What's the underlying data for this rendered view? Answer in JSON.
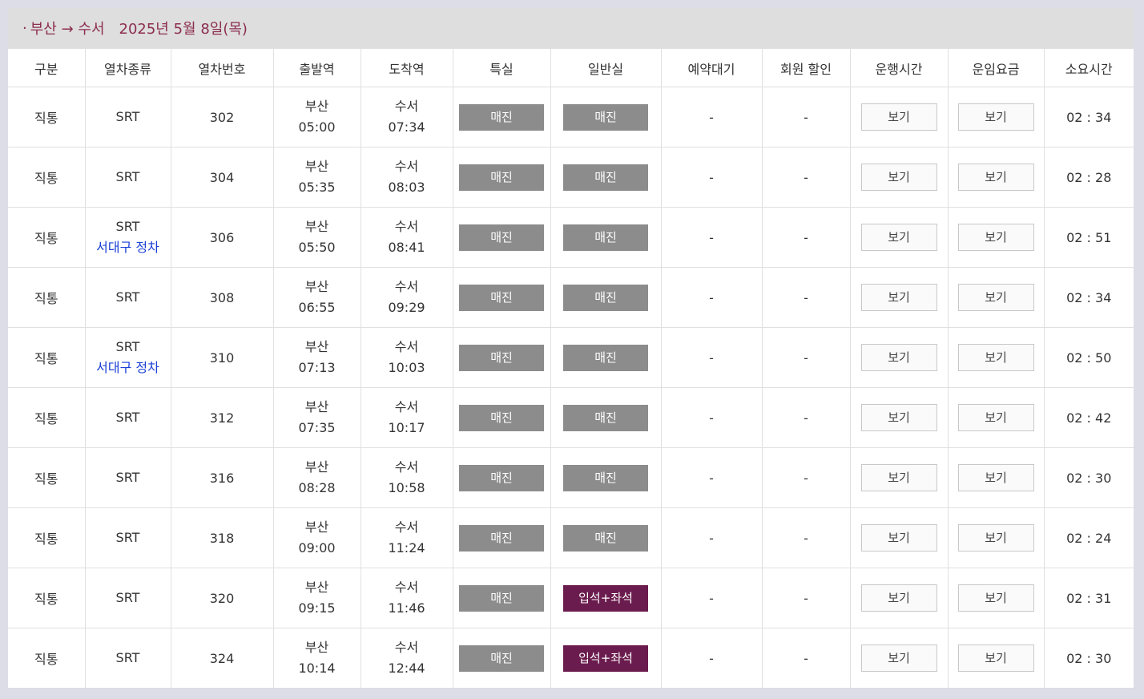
{
  "route": {
    "dot": "·",
    "text": "부산 → 수서",
    "date": "2025년 5월 8일(목)"
  },
  "headers": [
    "구분",
    "열차종류",
    "열차번호",
    "출발역",
    "도착역",
    "특실",
    "일반실",
    "예약대기",
    "회원 할인",
    "운행시간",
    "운임요금",
    "소요시간"
  ],
  "rows": [
    {
      "kind": "직통",
      "train": "SRT",
      "stop": "",
      "no": "302",
      "dep": "부산",
      "dep_time": "05:00",
      "arr": "수서",
      "arr_time": "07:34",
      "first": "매진",
      "first_avail": false,
      "std": "매진",
      "std_avail": false,
      "wait": "-",
      "discount": "-",
      "sched": "보기",
      "fare": "보기",
      "dur": "02 : 34"
    },
    {
      "kind": "직통",
      "train": "SRT",
      "stop": "",
      "no": "304",
      "dep": "부산",
      "dep_time": "05:35",
      "arr": "수서",
      "arr_time": "08:03",
      "first": "매진",
      "first_avail": false,
      "std": "매진",
      "std_avail": false,
      "wait": "-",
      "discount": "-",
      "sched": "보기",
      "fare": "보기",
      "dur": "02 : 28"
    },
    {
      "kind": "직통",
      "train": "SRT",
      "stop": "서대구 정차",
      "no": "306",
      "dep": "부산",
      "dep_time": "05:50",
      "arr": "수서",
      "arr_time": "08:41",
      "first": "매진",
      "first_avail": false,
      "std": "매진",
      "std_avail": false,
      "wait": "-",
      "discount": "-",
      "sched": "보기",
      "fare": "보기",
      "dur": "02 : 51"
    },
    {
      "kind": "직통",
      "train": "SRT",
      "stop": "",
      "no": "308",
      "dep": "부산",
      "dep_time": "06:55",
      "arr": "수서",
      "arr_time": "09:29",
      "first": "매진",
      "first_avail": false,
      "std": "매진",
      "std_avail": false,
      "wait": "-",
      "discount": "-",
      "sched": "보기",
      "fare": "보기",
      "dur": "02 : 34"
    },
    {
      "kind": "직통",
      "train": "SRT",
      "stop": "서대구 정차",
      "no": "310",
      "dep": "부산",
      "dep_time": "07:13",
      "arr": "수서",
      "arr_time": "10:03",
      "first": "매진",
      "first_avail": false,
      "std": "매진",
      "std_avail": false,
      "wait": "-",
      "discount": "-",
      "sched": "보기",
      "fare": "보기",
      "dur": "02 : 50"
    },
    {
      "kind": "직통",
      "train": "SRT",
      "stop": "",
      "no": "312",
      "dep": "부산",
      "dep_time": "07:35",
      "arr": "수서",
      "arr_time": "10:17",
      "first": "매진",
      "first_avail": false,
      "std": "매진",
      "std_avail": false,
      "wait": "-",
      "discount": "-",
      "sched": "보기",
      "fare": "보기",
      "dur": "02 : 42"
    },
    {
      "kind": "직통",
      "train": "SRT",
      "stop": "",
      "no": "316",
      "dep": "부산",
      "dep_time": "08:28",
      "arr": "수서",
      "arr_time": "10:58",
      "first": "매진",
      "first_avail": false,
      "std": "매진",
      "std_avail": false,
      "wait": "-",
      "discount": "-",
      "sched": "보기",
      "fare": "보기",
      "dur": "02 : 30"
    },
    {
      "kind": "직통",
      "train": "SRT",
      "stop": "",
      "no": "318",
      "dep": "부산",
      "dep_time": "09:00",
      "arr": "수서",
      "arr_time": "11:24",
      "first": "매진",
      "first_avail": false,
      "std": "매진",
      "std_avail": false,
      "wait": "-",
      "discount": "-",
      "sched": "보기",
      "fare": "보기",
      "dur": "02 : 24"
    },
    {
      "kind": "직통",
      "train": "SRT",
      "stop": "",
      "no": "320",
      "dep": "부산",
      "dep_time": "09:15",
      "arr": "수서",
      "arr_time": "11:46",
      "first": "매진",
      "first_avail": false,
      "std": "입석+좌석",
      "std_avail": true,
      "wait": "-",
      "discount": "-",
      "sched": "보기",
      "fare": "보기",
      "dur": "02 : 31"
    },
    {
      "kind": "직통",
      "train": "SRT",
      "stop": "",
      "no": "324",
      "dep": "부산",
      "dep_time": "10:14",
      "arr": "수서",
      "arr_time": "12:44",
      "first": "매진",
      "first_avail": false,
      "std": "입석+좌석",
      "std_avail": true,
      "wait": "-",
      "discount": "-",
      "sched": "보기",
      "fare": "보기",
      "dur": "02 : 30"
    }
  ],
  "colors": {
    "route_text": "#8c2d4f",
    "sold_out": "#8c8c8c",
    "available": "#6b1c4e",
    "stop_text": "#1a3fd6"
  }
}
